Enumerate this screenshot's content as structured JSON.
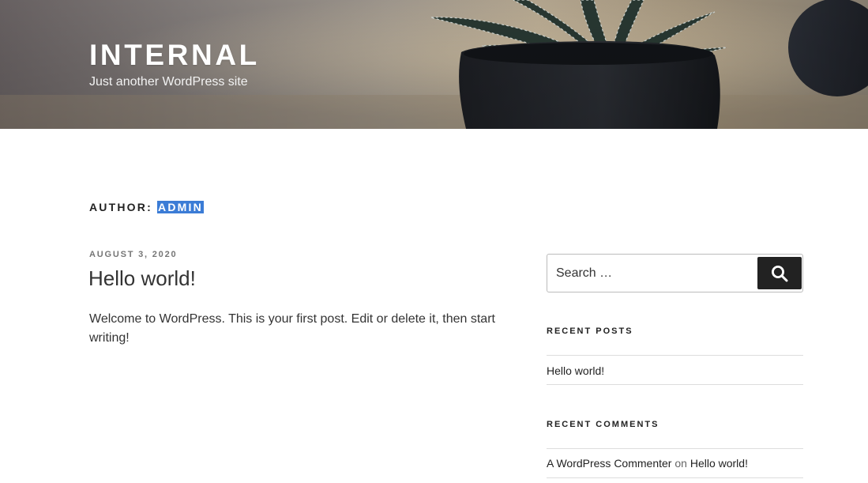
{
  "header": {
    "site_title": "INTERNAL",
    "tagline": "Just another WordPress site"
  },
  "archive": {
    "prefix": "AUTHOR:",
    "author": "ADMIN"
  },
  "post": {
    "date": "AUGUST 3, 2020",
    "title": "Hello world!",
    "excerpt": "Welcome to WordPress. This is your first post. Edit or delete it, then start writing!"
  },
  "sidebar": {
    "search": {
      "placeholder": "Search …",
      "button_icon": "search-icon"
    },
    "recent_posts": {
      "title": "RECENT POSTS",
      "items": [
        "Hello world!"
      ]
    },
    "recent_comments": {
      "title": "RECENT COMMENTS",
      "items": [
        {
          "author": "A WordPress Commenter",
          "separator": "on",
          "post": "Hello world!"
        }
      ]
    }
  },
  "colors": {
    "highlight": "#3b7cd6",
    "button": "#222222",
    "text": "#333333",
    "meta": "#767676"
  }
}
